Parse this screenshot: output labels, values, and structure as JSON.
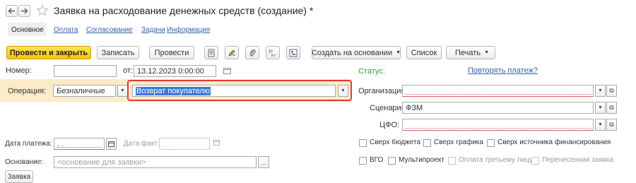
{
  "window": {
    "title": "Заявка на расходование денежных средств (создание) *"
  },
  "tabs": [
    {
      "label": "Основное"
    },
    {
      "label": "Оплата"
    },
    {
      "label": "Согласование"
    },
    {
      "label": "Задачи"
    },
    {
      "label": "Информация"
    }
  ],
  "toolbar": {
    "post_close": "Провести и закрыть",
    "save": "Записать",
    "post": "Провести",
    "create_based": "Создать на основании",
    "list": "Список",
    "print": "Печать"
  },
  "form": {
    "number_label": "Номер:",
    "number_value": "",
    "from_label": "от:",
    "date_value": "13.12.2023  0:00:00",
    "operation_label": "Операция:",
    "payment_form": "Безналичные",
    "operation_type": "Возврат покупателю",
    "pay_date_label": "Дата платежа:",
    "pay_date_value": ".  .",
    "fact_date_label": "Дата факт:",
    "fact_date_value": ".  .",
    "basis_label": "Основание:",
    "basis_placeholder": "<основание для заявки>",
    "status_label": "Статус:",
    "repeat_link": "Повторять платеж?",
    "org_label": "Организация:",
    "org_value": "",
    "scenario_label": "Сценарий:",
    "scenario_value": "ФЗМ",
    "cfo_label": "ЦФО:",
    "cfo_value": ""
  },
  "checkboxes": {
    "over_budget": "Сверх бюджета",
    "over_schedule": "Сверх графика",
    "over_source": "Сверх источника финансирования",
    "vgo": "ВГО",
    "multiproject": "Мультипроект",
    "third_party": "Оплата третьему лицу",
    "transferred": "Перенесенная заявка"
  },
  "bottom": {
    "partial_button": "Заявка"
  },
  "colors": {
    "accent_yellow": "#f5c400",
    "highlight_red": "#e53935",
    "status_green": "#3a9a3a",
    "link_blue": "#3a5fa8",
    "operation_band": "#fbebc8"
  }
}
